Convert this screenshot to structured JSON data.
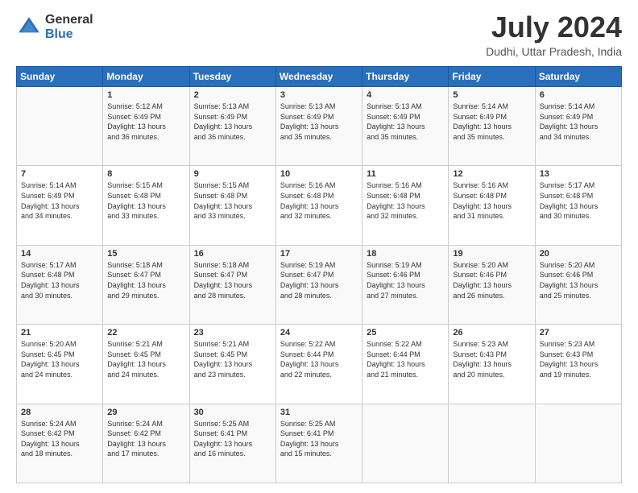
{
  "header": {
    "logo_general": "General",
    "logo_blue": "Blue",
    "month_title": "July 2024",
    "location": "Dudhi, Uttar Pradesh, India"
  },
  "days_of_week": [
    "Sunday",
    "Monday",
    "Tuesday",
    "Wednesday",
    "Thursday",
    "Friday",
    "Saturday"
  ],
  "weeks": [
    [
      {
        "day": "",
        "info": ""
      },
      {
        "day": "1",
        "info": "Sunrise: 5:12 AM\nSunset: 6:49 PM\nDaylight: 13 hours\nand 36 minutes."
      },
      {
        "day": "2",
        "info": "Sunrise: 5:13 AM\nSunset: 6:49 PM\nDaylight: 13 hours\nand 36 minutes."
      },
      {
        "day": "3",
        "info": "Sunrise: 5:13 AM\nSunset: 6:49 PM\nDaylight: 13 hours\nand 35 minutes."
      },
      {
        "day": "4",
        "info": "Sunrise: 5:13 AM\nSunset: 6:49 PM\nDaylight: 13 hours\nand 35 minutes."
      },
      {
        "day": "5",
        "info": "Sunrise: 5:14 AM\nSunset: 6:49 PM\nDaylight: 13 hours\nand 35 minutes."
      },
      {
        "day": "6",
        "info": "Sunrise: 5:14 AM\nSunset: 6:49 PM\nDaylight: 13 hours\nand 34 minutes."
      }
    ],
    [
      {
        "day": "7",
        "info": "Sunrise: 5:14 AM\nSunset: 6:49 PM\nDaylight: 13 hours\nand 34 minutes."
      },
      {
        "day": "8",
        "info": "Sunrise: 5:15 AM\nSunset: 6:48 PM\nDaylight: 13 hours\nand 33 minutes."
      },
      {
        "day": "9",
        "info": "Sunrise: 5:15 AM\nSunset: 6:48 PM\nDaylight: 13 hours\nand 33 minutes."
      },
      {
        "day": "10",
        "info": "Sunrise: 5:16 AM\nSunset: 6:48 PM\nDaylight: 13 hours\nand 32 minutes."
      },
      {
        "day": "11",
        "info": "Sunrise: 5:16 AM\nSunset: 6:48 PM\nDaylight: 13 hours\nand 32 minutes."
      },
      {
        "day": "12",
        "info": "Sunrise: 5:16 AM\nSunset: 6:48 PM\nDaylight: 13 hours\nand 31 minutes."
      },
      {
        "day": "13",
        "info": "Sunrise: 5:17 AM\nSunset: 6:48 PM\nDaylight: 13 hours\nand 30 minutes."
      }
    ],
    [
      {
        "day": "14",
        "info": "Sunrise: 5:17 AM\nSunset: 6:48 PM\nDaylight: 13 hours\nand 30 minutes."
      },
      {
        "day": "15",
        "info": "Sunrise: 5:18 AM\nSunset: 6:47 PM\nDaylight: 13 hours\nand 29 minutes."
      },
      {
        "day": "16",
        "info": "Sunrise: 5:18 AM\nSunset: 6:47 PM\nDaylight: 13 hours\nand 28 minutes."
      },
      {
        "day": "17",
        "info": "Sunrise: 5:19 AM\nSunset: 6:47 PM\nDaylight: 13 hours\nand 28 minutes."
      },
      {
        "day": "18",
        "info": "Sunrise: 5:19 AM\nSunset: 6:46 PM\nDaylight: 13 hours\nand 27 minutes."
      },
      {
        "day": "19",
        "info": "Sunrise: 5:20 AM\nSunset: 6:46 PM\nDaylight: 13 hours\nand 26 minutes."
      },
      {
        "day": "20",
        "info": "Sunrise: 5:20 AM\nSunset: 6:46 PM\nDaylight: 13 hours\nand 25 minutes."
      }
    ],
    [
      {
        "day": "21",
        "info": "Sunrise: 5:20 AM\nSunset: 6:45 PM\nDaylight: 13 hours\nand 24 minutes."
      },
      {
        "day": "22",
        "info": "Sunrise: 5:21 AM\nSunset: 6:45 PM\nDaylight: 13 hours\nand 24 minutes."
      },
      {
        "day": "23",
        "info": "Sunrise: 5:21 AM\nSunset: 6:45 PM\nDaylight: 13 hours\nand 23 minutes."
      },
      {
        "day": "24",
        "info": "Sunrise: 5:22 AM\nSunset: 6:44 PM\nDaylight: 13 hours\nand 22 minutes."
      },
      {
        "day": "25",
        "info": "Sunrise: 5:22 AM\nSunset: 6:44 PM\nDaylight: 13 hours\nand 21 minutes."
      },
      {
        "day": "26",
        "info": "Sunrise: 5:23 AM\nSunset: 6:43 PM\nDaylight: 13 hours\nand 20 minutes."
      },
      {
        "day": "27",
        "info": "Sunrise: 5:23 AM\nSunset: 6:43 PM\nDaylight: 13 hours\nand 19 minutes."
      }
    ],
    [
      {
        "day": "28",
        "info": "Sunrise: 5:24 AM\nSunset: 6:42 PM\nDaylight: 13 hours\nand 18 minutes."
      },
      {
        "day": "29",
        "info": "Sunrise: 5:24 AM\nSunset: 6:42 PM\nDaylight: 13 hours\nand 17 minutes."
      },
      {
        "day": "30",
        "info": "Sunrise: 5:25 AM\nSunset: 6:41 PM\nDaylight: 13 hours\nand 16 minutes."
      },
      {
        "day": "31",
        "info": "Sunrise: 5:25 AM\nSunset: 6:41 PM\nDaylight: 13 hours\nand 15 minutes."
      },
      {
        "day": "",
        "info": ""
      },
      {
        "day": "",
        "info": ""
      },
      {
        "day": "",
        "info": ""
      }
    ]
  ]
}
